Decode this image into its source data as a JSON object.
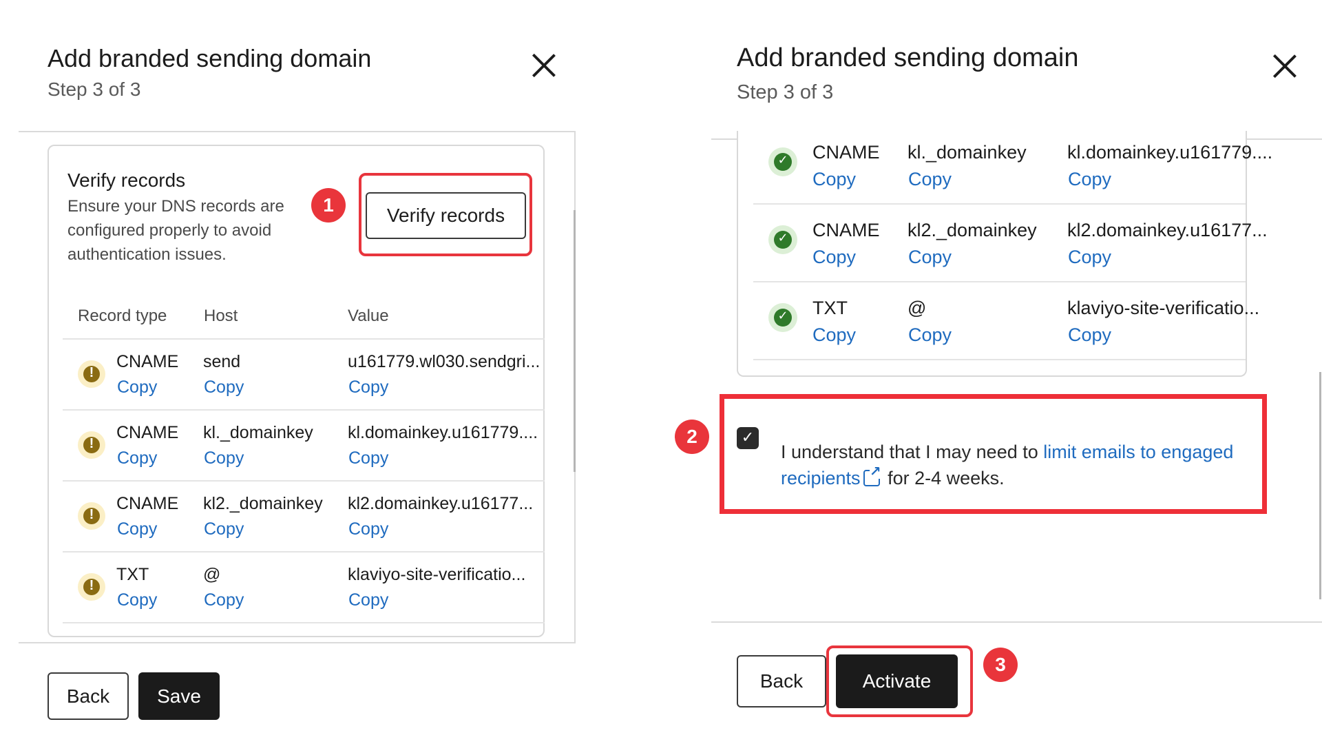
{
  "left": {
    "title": "Add branded sending domain",
    "step": "Step 3 of 3",
    "verify_section": {
      "title": "Verify records",
      "description": "Ensure your DNS records are configured properly to avoid authentication issues.",
      "button_label": "Verify records",
      "annotation": "1"
    },
    "table": {
      "headers": [
        "Record type",
        "Host",
        "Value"
      ],
      "rows": [
        {
          "status_icon": "warning-icon",
          "type": "CNAME",
          "host": "send",
          "value": "u161779.wl030.sendgri...",
          "copy": "Copy"
        },
        {
          "status_icon": "warning-icon",
          "type": "CNAME",
          "host": "kl._domainkey",
          "value": "kl.domainkey.u161779....",
          "copy": "Copy"
        },
        {
          "status_icon": "warning-icon",
          "type": "CNAME",
          "host": "kl2._domainkey",
          "value": "kl2.domainkey.u16177...",
          "copy": "Copy"
        },
        {
          "status_icon": "warning-icon",
          "type": "TXT",
          "host": "@",
          "value": "klaviyo-site-verificatio...",
          "copy": "Copy"
        }
      ]
    },
    "footer": {
      "back_label": "Back",
      "save_label": "Save"
    }
  },
  "right": {
    "title": "Add branded sending domain",
    "step": "Step 3 of 3",
    "table": {
      "rows": [
        {
          "status_icon": "check-icon",
          "type": "CNAME",
          "host": "kl._domainkey",
          "value": "kl.domainkey.u161779....",
          "copy": "Copy"
        },
        {
          "status_icon": "check-icon",
          "type": "CNAME",
          "host": "kl2._domainkey",
          "value": "kl2.domainkey.u16177...",
          "copy": "Copy"
        },
        {
          "status_icon": "check-icon",
          "type": "TXT",
          "host": "@",
          "value": "klaviyo-site-verificatio...",
          "copy": "Copy"
        }
      ]
    },
    "consent": {
      "annotation": "2",
      "checked": true,
      "text_before": "I understand that I may need to ",
      "link_text": "limit emails to engaged recipients",
      "text_after": " for 2-4 weeks."
    },
    "footer": {
      "back_label": "Back",
      "activate_label": "Activate",
      "annotation": "3"
    }
  },
  "colors": {
    "link": "#1f6bbf",
    "highlight": "#e8353d",
    "warning": "#8a6b12",
    "success": "#2f7a2a",
    "dark_button": "#1b1b1b"
  }
}
